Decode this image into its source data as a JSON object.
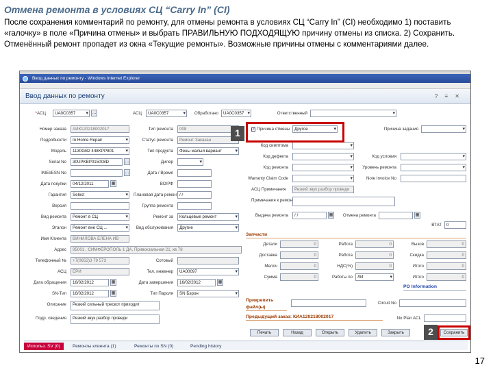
{
  "slide": {
    "title": "Отмена ремонта в условиях СЦ “Carry In” (CI)",
    "text": "После сохранения комментарий по ремонту, для отмены ремонта в условиях СЦ “Carry In” (CI) необходимо 1) поставить «галочку» в поле «Причина отмены» и выбрать ПРАВИЛЬНУЮ ПОДХОДЯЩУЮ причину отмены из списка. 2) Сохранить. Отменённый ремонт пропадет из окна «Текущие ремонты». Возможные причины отмены с комментариями далее.",
    "page_number": "17"
  },
  "window": {
    "title": "Ввод данных по ремонту - Windows Internet Explorer",
    "page_header": "Ввод данных по ремонту",
    "header_icons": "? ≡ ✕"
  },
  "form": {
    "top_row": [
      {
        "label": "АСЦ",
        "value": "UA0C0357"
      },
      {
        "label": "АСЦ",
        "value": "UA0C0357"
      },
      {
        "label": "Обработано",
        "value": "UA0C0357"
      },
      {
        "label": "Ответственный",
        "value": ""
      }
    ],
    "left_col": [
      {
        "label": "Номер заказа",
        "value": "АИК120218002017"
      },
      {
        "label": "Подробности",
        "value": "In Home Repair"
      },
      {
        "label": "Модель",
        "value": "1130GB2 448KPP801"
      },
      {
        "label": "Serial No",
        "value": "30UPKBP015008D"
      },
      {
        "label": "IMEI/ESN No",
        "value": ""
      },
      {
        "label": "Дата покупки",
        "value": "04/12/2011"
      },
      {
        "label": "Гарантия",
        "value": "Select"
      },
      {
        "label": "Версия",
        "value": ""
      },
      {
        "label": "Вид ремонта",
        "value": "Ремонт в СЦ"
      },
      {
        "label": "Эталон",
        "value": "Ремонт вне СЦ ..."
      },
      {
        "label": "Имя Клиента",
        "value": "ВИНИЛОВА ЕЛЕНА ИВ"
      },
      {
        "label": "Адрес",
        "value": "95001 , СИМФЕРОПОЛЬ 1 ДА, Привокзальная 21, кв 78"
      },
      {
        "label": "Телефонный №",
        "value": "+7(0652)3 79 573"
      },
      {
        "label": "АСЦ",
        "value": "ЕРИ"
      },
      {
        "label": "Дата обращения",
        "value": "16/02/2012"
      },
      {
        "label": "SN-Тип",
        "value": "16/02/2012"
      },
      {
        "label": "Описание",
        "value": "Резкий сильный трескот приходит"
      },
      {
        "label": "Подр. сведения",
        "value": "Резкий звук разбор проведи"
      }
    ],
    "mid_col": [
      {
        "label": "Тип ремонта",
        "value": "008"
      },
      {
        "label": "Статус ремонта",
        "value": "Ремонт Заказан"
      },
      {
        "label": "Тип продукта",
        "value": "Фены малый вариант"
      },
      {
        "label": "Дилер",
        "value": ""
      },
      {
        "label": "Дата / Время",
        "value": ""
      },
      {
        "label": "ВО/РФ",
        "value": ""
      },
      {
        "label": "Плановая дата ремонта",
        "value": "/ /"
      },
      {
        "label": "Группа ремонта",
        "value": ""
      },
      {
        "label": "Ремонт за",
        "value": "Кольцевые ремонт"
      },
      {
        "label": "Вид обслуживания",
        "value": "Другие"
      },
      {
        "label": "Сотовый",
        "value": ""
      },
      {
        "label": "Тел. инженер",
        "value": "UA00097"
      },
      {
        "label": "Дата завершения",
        "value": "16/02/2012"
      },
      {
        "label": "Тип Пароля",
        "value": "SN Бэрон"
      }
    ],
    "right_col": [
      {
        "label": "Причина отмены",
        "value": "Другое",
        "checked": true
      },
      {
        "label": "Причина задания",
        "value": ""
      },
      {
        "label": "Код симптома",
        "value": ""
      },
      {
        "label": "Код дефекта",
        "value": ""
      },
      {
        "label": "Код ремонта",
        "value": ""
      },
      {
        "label": "Warranty Claim Code",
        "value": ""
      },
      {
        "label": "АСЦ Примечания",
        "value": "Резкий звук разбор проведи"
      },
      {
        "label": "Примечания к ремонту",
        "value": ""
      },
      {
        "label": "Выдача ремонта",
        "value": "/ /"
      }
    ],
    "far_right_col": [
      {
        "label": "Код условия",
        "value": ""
      },
      {
        "label": "Уровень ремонта",
        "value": ""
      },
      {
        "label": "Note Invoice No",
        "value": ""
      },
      {
        "label": "Отмена ремонта",
        "value": ""
      },
      {
        "label": "ВТАТ",
        "value": "0"
      }
    ],
    "sections": {
      "parts": "Запчасти",
      "po_info": "PO Information",
      "attachments": "Прикрепить файл(ы)",
      "prev_order": "Предыдущий заказ: КИА120218002017"
    },
    "parts_labels": [
      "Детали",
      "Работа",
      "Вызов",
      "Доставка",
      "Работа",
      "Скидка",
      "Мелоч",
      "НДС(%)",
      "Итого",
      "Работы по",
      "Сумма",
      "Итого"
    ],
    "parts_values": [
      "0",
      "0",
      "0",
      "0",
      "0",
      "0",
      "0",
      "0",
      "0",
      "ЛИ",
      "0",
      "0"
    ],
    "bottom_row": [
      {
        "label": "Circuit No",
        "value": ""
      },
      {
        "label": "No Plan ACL",
        "value": ""
      }
    ],
    "bottom_buttons": [
      "Печать",
      "Назад",
      "Открыть",
      "Удалить",
      "Закрыть",
      "Сохранить"
    ]
  },
  "tabs": [
    "Использ. SV (0)",
    "Ремонты клиента (1)",
    "Ремонты по SN (0)",
    "Pending history"
  ],
  "markers": {
    "one": "1",
    "two": "2"
  }
}
